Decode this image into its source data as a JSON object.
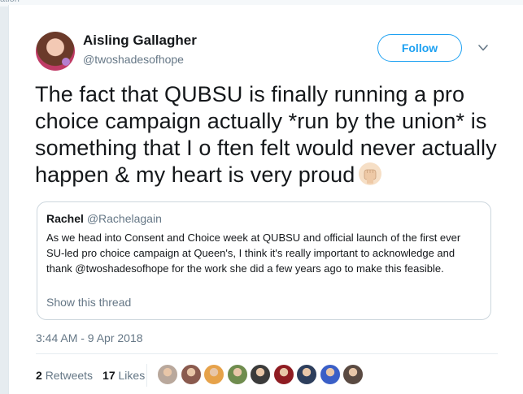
{
  "tweet": {
    "author_name": "Aisling Gallagher",
    "author_handle": "@twoshadesofhope",
    "follow_label": "Follow",
    "text": "The fact that QUBSU is finally running a pro choice campaign actually *run by the union* is something that I o ften felt would never actually happen & my heart is very proud",
    "emoji": "raised-fist-icon",
    "timestamp": "3:44 AM - 9 Apr 2018"
  },
  "quoted_tweet": {
    "author_name": "Rachel",
    "author_handle": "@Rachelagain",
    "text": "As we head into Consent and Choice week at QUBSU and  official launch of the first ever SU-led pro choice campaign at Queen's, I think it's really important to acknowledge and thank @twoshadesofhope for the work she did a few years ago to make this feasible.",
    "show_thread_label": "Show this thread"
  },
  "stats": {
    "retweets_count": "2",
    "retweets_label": "Retweets",
    "likes_count": "17",
    "likes_label": "Likes"
  },
  "likers": [
    {
      "color": "#b9a89c"
    },
    {
      "color": "#8a5a4e"
    },
    {
      "color": "#e6a24a"
    },
    {
      "color": "#6f8c4e"
    },
    {
      "color": "#3b3b3b"
    },
    {
      "color": "#8f1c22"
    },
    {
      "color": "#2d3e5c"
    },
    {
      "color": "#3a5fc7"
    },
    {
      "color": "#5a4a42"
    }
  ],
  "colors": {
    "accent": "#1da1f2",
    "text_primary": "#14171a",
    "text_secondary": "#657786"
  }
}
